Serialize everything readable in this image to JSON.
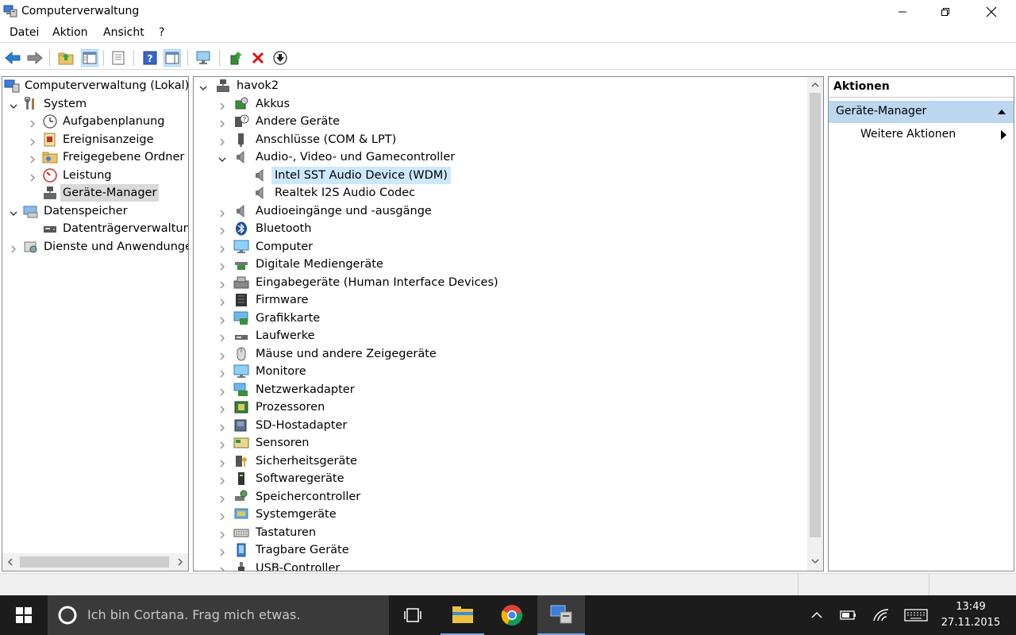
{
  "window": {
    "title": "Computerverwaltung"
  },
  "menu": [
    "Datei",
    "Aktion",
    "Ansicht",
    "?"
  ],
  "left_tree": [
    {
      "label": "Computerverwaltung (Lokal)",
      "level": 0,
      "expander": "none",
      "icon": "computer-management-icon"
    },
    {
      "label": "System",
      "level": 1,
      "expander": "expanded",
      "icon": "tools-icon"
    },
    {
      "label": "Aufgabenplanung",
      "level": 2,
      "expander": "collapsed",
      "icon": "clock-icon"
    },
    {
      "label": "Ereignisanzeige",
      "level": 2,
      "expander": "collapsed",
      "icon": "event-viewer-icon"
    },
    {
      "label": "Freigegebene Ordner",
      "level": 2,
      "expander": "collapsed",
      "icon": "shared-folder-icon"
    },
    {
      "label": "Leistung",
      "level": 2,
      "expander": "collapsed",
      "icon": "performance-icon"
    },
    {
      "label": "Geräte-Manager",
      "level": 2,
      "expander": "none",
      "icon": "device-manager-icon",
      "selected": true
    },
    {
      "label": "Datenspeicher",
      "level": 1,
      "expander": "expanded",
      "icon": "storage-icon"
    },
    {
      "label": "Datenträgerverwaltung",
      "level": 2,
      "expander": "none",
      "icon": "disk-management-icon"
    },
    {
      "label": "Dienste und Anwendungen",
      "level": 1,
      "expander": "collapsed",
      "icon": "services-icon"
    }
  ],
  "device_tree": {
    "root": "havok2",
    "items": [
      {
        "label": "Akkus",
        "icon": "battery-icon",
        "expander": "collapsed"
      },
      {
        "label": "Andere Geräte",
        "icon": "unknown-device-icon",
        "expander": "collapsed"
      },
      {
        "label": "Anschlüsse (COM & LPT)",
        "icon": "port-icon",
        "expander": "collapsed"
      },
      {
        "label": "Audio-, Video- und Gamecontroller",
        "icon": "speaker-icon",
        "expander": "expanded"
      },
      {
        "label": "Intel SST Audio Device (WDM)",
        "icon": "speaker-icon",
        "expander": "none",
        "child": true,
        "selected": true
      },
      {
        "label": "Realtek I2S Audio Codec",
        "icon": "speaker-icon",
        "expander": "none",
        "child": true
      },
      {
        "label": "Audioeingänge und -ausgänge",
        "icon": "speaker-icon",
        "expander": "collapsed"
      },
      {
        "label": "Bluetooth",
        "icon": "bluetooth-icon",
        "expander": "collapsed"
      },
      {
        "label": "Computer",
        "icon": "monitor-icon",
        "expander": "collapsed"
      },
      {
        "label": "Digitale Mediengeräte",
        "icon": "media-device-icon",
        "expander": "collapsed"
      },
      {
        "label": "Eingabegeräte (Human Interface Devices)",
        "icon": "hid-icon",
        "expander": "collapsed"
      },
      {
        "label": "Firmware",
        "icon": "chip-icon",
        "expander": "collapsed"
      },
      {
        "label": "Grafikkarte",
        "icon": "display-adapter-icon",
        "expander": "collapsed"
      },
      {
        "label": "Laufwerke",
        "icon": "drive-icon",
        "expander": "collapsed"
      },
      {
        "label": "Mäuse und andere Zeigegeräte",
        "icon": "mouse-icon",
        "expander": "collapsed"
      },
      {
        "label": "Monitore",
        "icon": "monitor-icon",
        "expander": "collapsed"
      },
      {
        "label": "Netzwerkadapter",
        "icon": "network-icon",
        "expander": "collapsed"
      },
      {
        "label": "Prozessoren",
        "icon": "processor-icon",
        "expander": "collapsed"
      },
      {
        "label": "SD-Hostadapter",
        "icon": "sd-icon",
        "expander": "collapsed"
      },
      {
        "label": "Sensoren",
        "icon": "sensor-icon",
        "expander": "collapsed"
      },
      {
        "label": "Sicherheitsgeräte",
        "icon": "security-device-icon",
        "expander": "collapsed"
      },
      {
        "label": "Softwaregeräte",
        "icon": "software-device-icon",
        "expander": "collapsed"
      },
      {
        "label": "Speichercontroller",
        "icon": "storage-controller-icon",
        "expander": "collapsed"
      },
      {
        "label": "Systemgeräte",
        "icon": "system-device-icon",
        "expander": "collapsed"
      },
      {
        "label": "Tastaturen",
        "icon": "keyboard-icon",
        "expander": "collapsed"
      },
      {
        "label": "Tragbare Geräte",
        "icon": "portable-device-icon",
        "expander": "collapsed"
      },
      {
        "label": "USB-Controller",
        "icon": "usb-icon",
        "expander": "collapsed"
      }
    ]
  },
  "actions": {
    "header": "Aktionen",
    "section": "Geräte-Manager",
    "item": "Weitere Aktionen"
  },
  "taskbar": {
    "cortana_placeholder": "Ich bin Cortana. Frag mich etwas.",
    "time": "13:49",
    "date": "27.11.2015"
  },
  "colors": {
    "selection_blue": "#cce8ff",
    "selection_grey": "#d9d9d9",
    "actions_section": "#bcd7ef",
    "taskbar": "#1c1c1c"
  }
}
